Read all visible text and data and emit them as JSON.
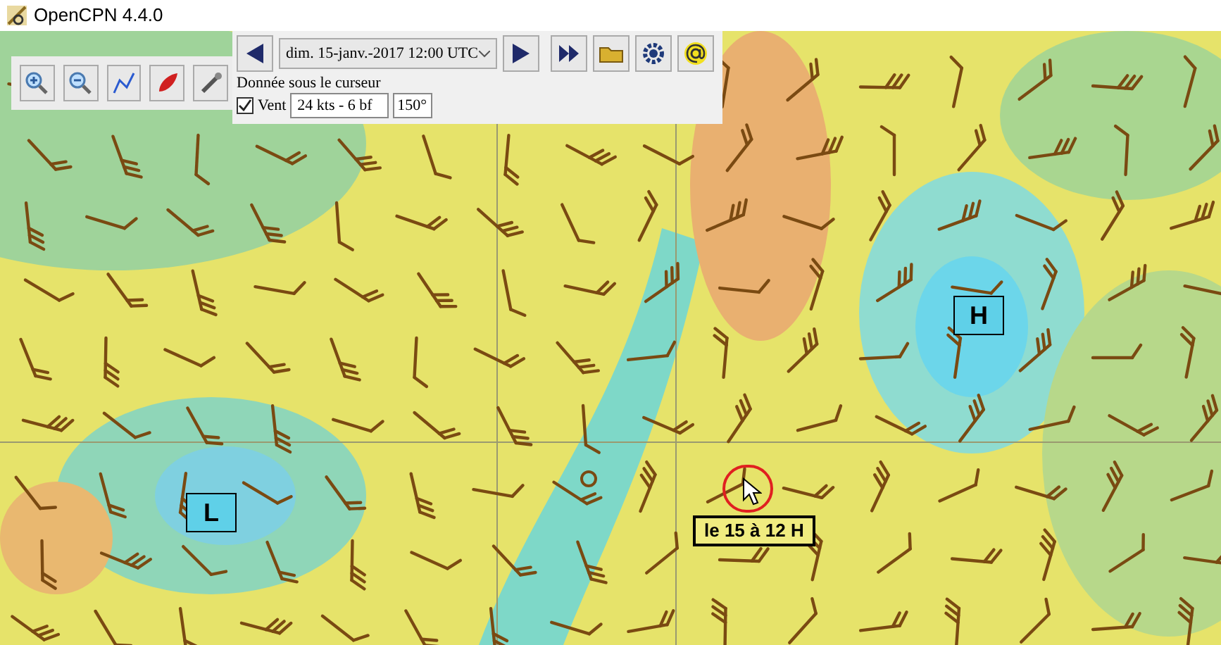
{
  "window": {
    "title": "OpenCPN 4.4.0"
  },
  "grib_panel": {
    "date": "dim. 15-janv.-2017 12:00  UTC",
    "caption": "Donnée sous le curseur",
    "wind": {
      "label": "Vent",
      "checked": true,
      "speed": "24 kts - 6 bf",
      "direction": "150°"
    }
  },
  "map": {
    "pressure_labels": [
      "L",
      "H"
    ],
    "annotation": "le 15 à 12 H"
  }
}
